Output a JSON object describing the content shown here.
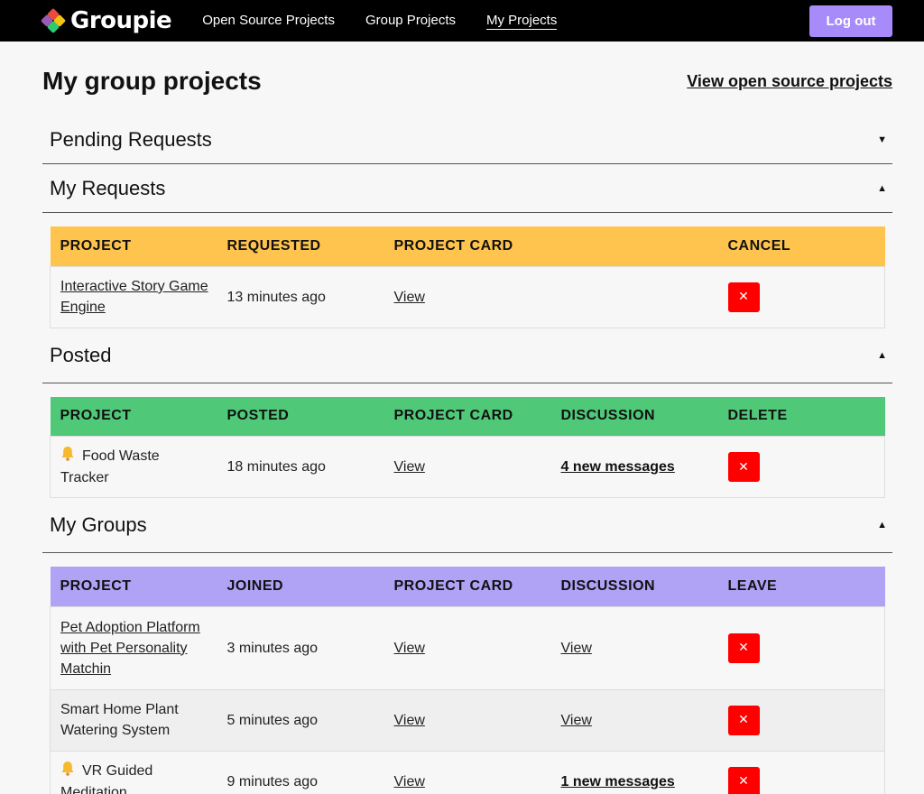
{
  "app": {
    "name": "Groupie"
  },
  "nav": {
    "links": [
      "Open Source Projects",
      "Group Projects",
      "My Projects"
    ],
    "logout_label": "Log out"
  },
  "page": {
    "title": "My group projects",
    "open_source_link": "View open source projects"
  },
  "sections": {
    "pending": {
      "title": "Pending Requests",
      "expanded": false
    },
    "requests": {
      "title": "My Requests",
      "expanded": true,
      "header_color": "#ffc44d",
      "columns": [
        "PROJECT",
        "REQUESTED",
        "PROJECT CARD",
        "",
        "CANCEL"
      ],
      "rows": [
        {
          "project": "Interactive Story Game Engine",
          "time": "13 minutes ago",
          "card": "View"
        }
      ]
    },
    "posted": {
      "title": "Posted",
      "expanded": true,
      "header_color": "#4fc978",
      "columns": [
        "PROJECT",
        "POSTED",
        "PROJECT CARD",
        "DISCUSSION",
        "DELETE"
      ],
      "rows": [
        {
          "project": "Food Waste Tracker",
          "bell": true,
          "time": "18 minutes ago",
          "card": "View",
          "discussion": "4 new messages"
        }
      ]
    },
    "groups": {
      "title": "My Groups",
      "expanded": true,
      "header_color": "#b0a2f5",
      "columns": [
        "PROJECT",
        "JOINED",
        "PROJECT CARD",
        "DISCUSSION",
        "LEAVE"
      ],
      "rows": [
        {
          "project": "Pet Adoption Platform with Pet Personality Matchin",
          "time": "3 minutes ago",
          "card": "View",
          "discussion": "View"
        },
        {
          "project": "Smart Home Plant Watering System",
          "time": "5 minutes ago",
          "card": "View",
          "discussion": "View"
        },
        {
          "project": "VR Guided Meditation",
          "bell": true,
          "time": "9 minutes ago",
          "card": "View",
          "discussion": "1 new messages"
        }
      ]
    }
  },
  "icons": {
    "expand": "caret-down-icon",
    "collapse": "caret-up-icon",
    "remove": "x-icon",
    "notification": "bell-icon"
  }
}
